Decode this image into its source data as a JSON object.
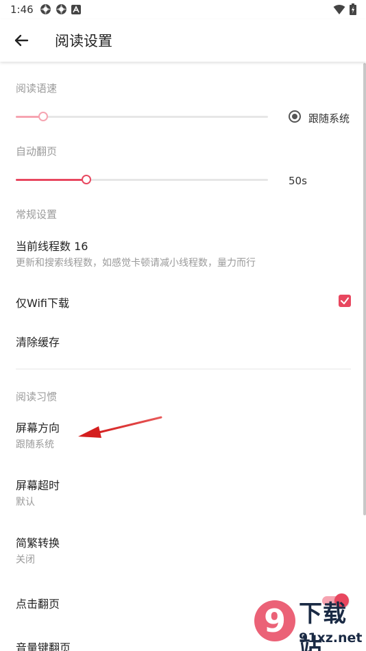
{
  "status_bar": {
    "time": "1:46",
    "left_icons": [
      "app-notification-icon",
      "app-notification-icon",
      "font-a-icon"
    ],
    "right_icons": [
      "wifi-icon",
      "battery-charging-icon"
    ]
  },
  "app_bar": {
    "title": "阅读设置",
    "back_icon": "arrow-left-icon"
  },
  "reading_speed": {
    "header": "阅读语速",
    "slider_value_fraction": 0.11,
    "follow_system_label": "跟随系统",
    "follow_system_selected": true
  },
  "auto_page": {
    "header": "自动翻页",
    "slider_value_fraction": 0.28,
    "value_text": "50s"
  },
  "general": {
    "header": "常规设置",
    "thread_title": "当前线程数 16",
    "thread_summary": "更新和搜索线程数，如感觉卡顿请减小线程数，量力而行",
    "wifi_only_label": "仅Wifi下载",
    "wifi_only_checked": true,
    "clear_cache_label": "清除缓存"
  },
  "habits": {
    "header": "阅读习惯",
    "orientation_title": "屏幕方向",
    "orientation_value": "跟随系统",
    "timeout_title": "屏幕超时",
    "timeout_value": "默认",
    "conversion_title": "简繁转换",
    "conversion_value": "关闭",
    "tap_page_label": "点击翻页",
    "tap_page_on": true,
    "volume_key_label": "音量键翻页"
  },
  "colors": {
    "accent": "#e8475f",
    "accent_light": "#f6a4b1",
    "arrow_annotation": "#d41e1e"
  },
  "watermark": {
    "top_text": "下载站",
    "bottom_text": "91xz.net",
    "logo_digit": "9"
  }
}
